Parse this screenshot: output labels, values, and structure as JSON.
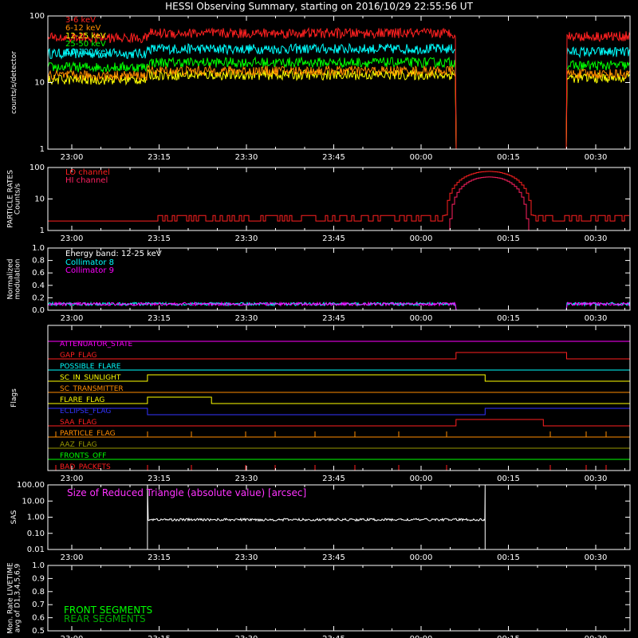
{
  "title": "HESSI Observing Summary, starting on 2016/10/29 22:55:56 UT",
  "time_ticks": [
    "23:00",
    "23:15",
    "23:30",
    "23:45",
    "00:00",
    "00:15",
    "00:30"
  ],
  "chart_data": [
    {
      "id": "count-rates",
      "type": "line",
      "ylabel": "counts/s/detector",
      "yscale": "log",
      "ylim": [
        1,
        100
      ],
      "y_tick_labels": [
        "1",
        "10",
        "100"
      ],
      "gap": [
        "00:06",
        "00:25"
      ],
      "series": [
        {
          "name": "3-6 keV",
          "color": "#ff2020",
          "level": 55
        },
        {
          "name": "6-12 keV",
          "color": "#ff8c00",
          "level": 15
        },
        {
          "name": "12-25 keV",
          "color": "#ffff00",
          "level": 13
        },
        {
          "name": "25-50 keV",
          "color": "#00ff00",
          "level": 20
        },
        {
          "name": "50-100 keV",
          "color": "#00ffff",
          "level": 32
        }
      ]
    },
    {
      "id": "particle-rates",
      "type": "line",
      "ylabel": "PARTICLE RATES Counts/s",
      "yscale": "log",
      "ylim": [
        1,
        100
      ],
      "y_tick_labels": [
        "1",
        "10",
        "100"
      ],
      "series": [
        {
          "name": "LO channel",
          "color": "#ff2020",
          "baseline": 2,
          "peak": 75
        },
        {
          "name": "HI channel",
          "color": "#ff2060",
          "baseline": 1,
          "peak": 50
        }
      ]
    },
    {
      "id": "modulation",
      "type": "line",
      "ylabel": "Normalized modulation",
      "ylim": [
        0,
        1
      ],
      "y_tick_labels": [
        "0.0",
        "0.2",
        "0.4",
        "0.6",
        "0.8",
        "1.0"
      ],
      "energy_band": "Energy band: 12-25 keV",
      "series": [
        {
          "name": "Collimator 8",
          "color": "#00ffff",
          "level": 0.1
        },
        {
          "name": "Collimator 9",
          "color": "#ff00ff",
          "level": 0.1
        }
      ]
    },
    {
      "id": "flags",
      "type": "flags",
      "ylabel": "Flags",
      "items": [
        {
          "name": "ATTENUATOR_STATE",
          "color": "#ff00ff"
        },
        {
          "name": "GAP_FLAG",
          "color": "#ff2020"
        },
        {
          "name": "POSSIBLE_FLARE",
          "color": "#00ffff"
        },
        {
          "name": "SC_IN_SUNLIGHT",
          "color": "#ffff00"
        },
        {
          "name": "SC_TRANSMITTER",
          "color": "#ff8c00"
        },
        {
          "name": "FLARE_FLAG",
          "color": "#ffff00"
        },
        {
          "name": "ECLIPSE_FLAG",
          "color": "#3333ff"
        },
        {
          "name": "SAA_FLAG",
          "color": "#ff2020"
        },
        {
          "name": "PARTICLE_FLAG",
          "color": "#ff8c00"
        },
        {
          "name": "AAZ_FLAG",
          "color": "#999900"
        },
        {
          "name": "FRONTS_OFF",
          "color": "#00ff00"
        },
        {
          "name": "BAD_PACKETS",
          "color": "#ff2020"
        }
      ]
    },
    {
      "id": "sas",
      "type": "line",
      "ylabel": "SAS",
      "yscale": "log",
      "ylim": [
        0.01,
        100
      ],
      "y_tick_labels": [
        "0.01",
        "0.10",
        "1.00",
        "10.00",
        "100.00"
      ],
      "annotation": "Size of Reduced Triangle (absolute value) [arcsec]",
      "series": [
        {
          "color": "#ffffff",
          "level": 0.7,
          "range": [
            "23:13",
            "00:11"
          ]
        }
      ]
    },
    {
      "id": "livetime",
      "type": "line",
      "ylabel": "Mon. Rate LIVETIME avg of D1,3,4,5,6,9",
      "ylim": [
        0.5,
        1.0
      ],
      "y_tick_labels": [
        "0.5",
        "0.6",
        "0.7",
        "0.8",
        "0.9",
        "1.0"
      ],
      "series": [
        {
          "name": "FRONT SEGMENTS",
          "color": "#00ff00"
        },
        {
          "name": "REAR SEGMENTS",
          "color": "#00aa00"
        }
      ]
    }
  ]
}
